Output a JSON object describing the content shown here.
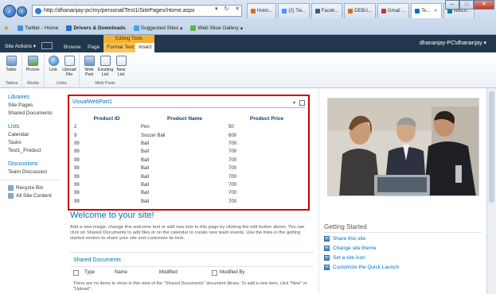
{
  "browser": {
    "address": "http://dhananjay-pc/my/personal/Test1/SitePages/Home.aspx",
    "tabs": [
      "Hotm...",
      "(2) Tw...",
      "Faceb...",
      "DEBU...",
      "Gmail ...",
      "Te...",
      "Welco..."
    ],
    "favorites": [
      "Twitter - Home",
      "Drivers & Downloads",
      "Suggested Sites",
      "Web Slice Gallery"
    ],
    "window_buttons": [
      "–",
      "□",
      "✕"
    ]
  },
  "ribbon_top": {
    "site_actions": "Site Actions",
    "tabs": [
      "Browse",
      "Page"
    ],
    "context_label": "Editing Tools",
    "context_tabs": [
      "Format Text",
      "Insert"
    ],
    "user": "dhananjay-PC\\dhananjay"
  },
  "ribbon": {
    "buttons": [
      {
        "label": "Table",
        "icon": "table-icon"
      },
      {
        "label": "Picture",
        "icon": "picture-icon"
      },
      {
        "label": "Link",
        "icon": "link-icon"
      },
      {
        "label": "Upload File",
        "icon": "upload-file-icon"
      },
      {
        "label": "Web Part",
        "icon": "web-part-icon"
      },
      {
        "label": "Existing List",
        "icon": "existing-list-icon"
      },
      {
        "label": "New List",
        "icon": "new-list-icon"
      }
    ],
    "groups": [
      "Tables",
      "Media",
      "Links",
      "Web Parts"
    ]
  },
  "quicklaunch": {
    "libraries": "Libraries",
    "site_pages": "Site Pages",
    "shared_documents": "Shared Documents",
    "lists": "Lists",
    "calendar": "Calendar",
    "tasks": "Tasks",
    "test1_product": "Test1_Product",
    "discussions": "Discussions",
    "team_discussion": "Team Discussion",
    "recycle_bin": "Recycle Bin",
    "all_site_content": "All Site Content"
  },
  "webpart": {
    "title": "VisualWebPart1",
    "headers": [
      "Product ID",
      "Product Name",
      "Product Price"
    ],
    "rows": [
      [
        "2",
        "Pen",
        "50"
      ],
      [
        "9",
        "Soccer Ball",
        "600"
      ],
      [
        "99",
        "Ball",
        "700"
      ],
      [
        "99",
        "Ball",
        "700"
      ],
      [
        "99",
        "Ball",
        "700"
      ],
      [
        "99",
        "Ball",
        "700"
      ],
      [
        "99",
        "Ball",
        "700"
      ],
      [
        "99",
        "Ball",
        "700"
      ],
      [
        "99",
        "Ball",
        "700"
      ],
      [
        "99",
        "Ball",
        "700"
      ]
    ]
  },
  "main": {
    "welcome": "Welcome to your site!",
    "intro": "Add a new image, change this welcome text or add new lists to this page by clicking the edit button above. You can click on Shared Documents to add files or on the calendar to create new team events. Use the links in the getting started section to share your site and customize its look.",
    "shared_documents_title": "Shared Documents",
    "columns": [
      "Type",
      "Name",
      "Modified",
      "Modified By"
    ],
    "empty_message": "There are no items to show in this view of the \"Shared Documents\" document library. To add a new item, click \"New\" or \"Upload\"."
  },
  "getting_started": {
    "title": "Getting Started",
    "items": [
      "Share this site",
      "Change site theme",
      "Set a site icon",
      "Customize the Quick Launch"
    ]
  }
}
